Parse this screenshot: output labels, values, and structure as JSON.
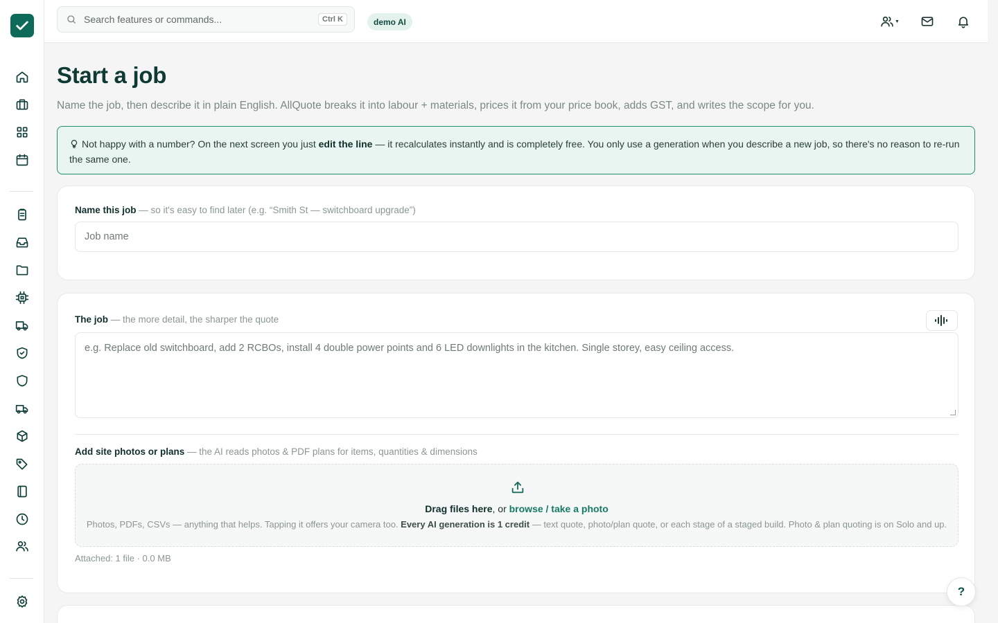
{
  "search": {
    "placeholder": "Search features or commands...",
    "shortcut": "Ctrl K"
  },
  "header": {
    "badge": "demo AI"
  },
  "page": {
    "title": "Start a job",
    "subtitle": "Name the job, then describe it in plain English. AllQuote breaks it into labour + materials, prices it from your price book, adds GST, and writes the scope for you."
  },
  "tip": {
    "before": "Not happy with a number? On the next screen you just ",
    "bold": "edit the line",
    "after": " — it recalculates instantly and is completely free. You only use a generation when you describe a new job, so there's no reason to re-run the same one."
  },
  "job_name": {
    "label": "Name this job",
    "hint": " — so it's easy to find later (e.g. “Smith St — switchboard upgrade”)",
    "placeholder": "Job name"
  },
  "job_desc": {
    "label": "The job",
    "hint": " — the more detail, the sharper the quote",
    "placeholder": "e.g. Replace old switchboard, add 2 RCBOs, install 4 double power points and 6 LED downlights in the kitchen. Single storey, easy ceiling access."
  },
  "photos": {
    "label": "Add site photos or plans",
    "hint": " — the AI reads photos & PDF plans for items, quantities & dimensions",
    "drop_bold": "Drag files here",
    "drop_mid": ", or ",
    "drop_link": "browse / take a photo",
    "sub_before": "Photos, PDFs, CSVs — anything that helps. Tapping it offers your camera too. ",
    "sub_bold": "Every AI generation is 1 credit",
    "sub_after": " — text quote, photo/plan quote, or each stage of a staged build. Photo & plan quoting is on Solo and up.",
    "attached": "Attached: 1 file · 0.0 MB"
  },
  "help": {
    "label": "?"
  },
  "colors": {
    "accent": "#0e6b5a",
    "tip_border": "#1f8c72",
    "tip_bg": "#e8f5f1",
    "link": "#147a63"
  },
  "icons": {
    "sidebar": [
      "home-icon",
      "briefcase-icon",
      "grid-icon",
      "calendar-icon",
      "clipboard-icon",
      "inbox-icon",
      "folder-icon",
      "chip-icon",
      "truck-icon",
      "shield-check-icon",
      "shield-icon",
      "delivery-truck-icon",
      "box-icon",
      "tag-icon",
      "book-icon",
      "clock-icon",
      "users-icon",
      "settings-icon"
    ],
    "topbar": [
      "team-icon",
      "mail-icon",
      "bell-icon"
    ]
  }
}
